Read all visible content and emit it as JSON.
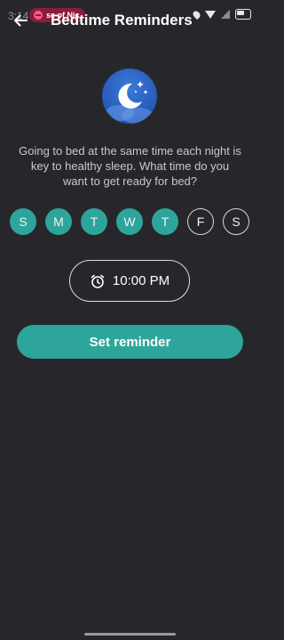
{
  "status_bar": {
    "time": "3:14",
    "media_pill_text": "se of Nic"
  },
  "header": {
    "title": "Bedtime Reminders"
  },
  "hero": {
    "icon": "moon-stars-icon"
  },
  "description": "Going to bed at the same time each night is key to healthy sleep. What time do you want to get ready for bed?",
  "days": [
    {
      "label": "S",
      "selected": true
    },
    {
      "label": "M",
      "selected": true
    },
    {
      "label": "T",
      "selected": true
    },
    {
      "label": "W",
      "selected": true
    },
    {
      "label": "T",
      "selected": true
    },
    {
      "label": "F",
      "selected": false
    },
    {
      "label": "S",
      "selected": false
    }
  ],
  "time_picker": {
    "value": "10:00 PM",
    "icon": "alarm-clock-icon"
  },
  "set_button": {
    "label": "Set reminder"
  },
  "colors": {
    "background": "#27272b",
    "accent": "#2ea59a",
    "media_pill": "#8a1d3a",
    "hero": "#2a5fc0"
  }
}
